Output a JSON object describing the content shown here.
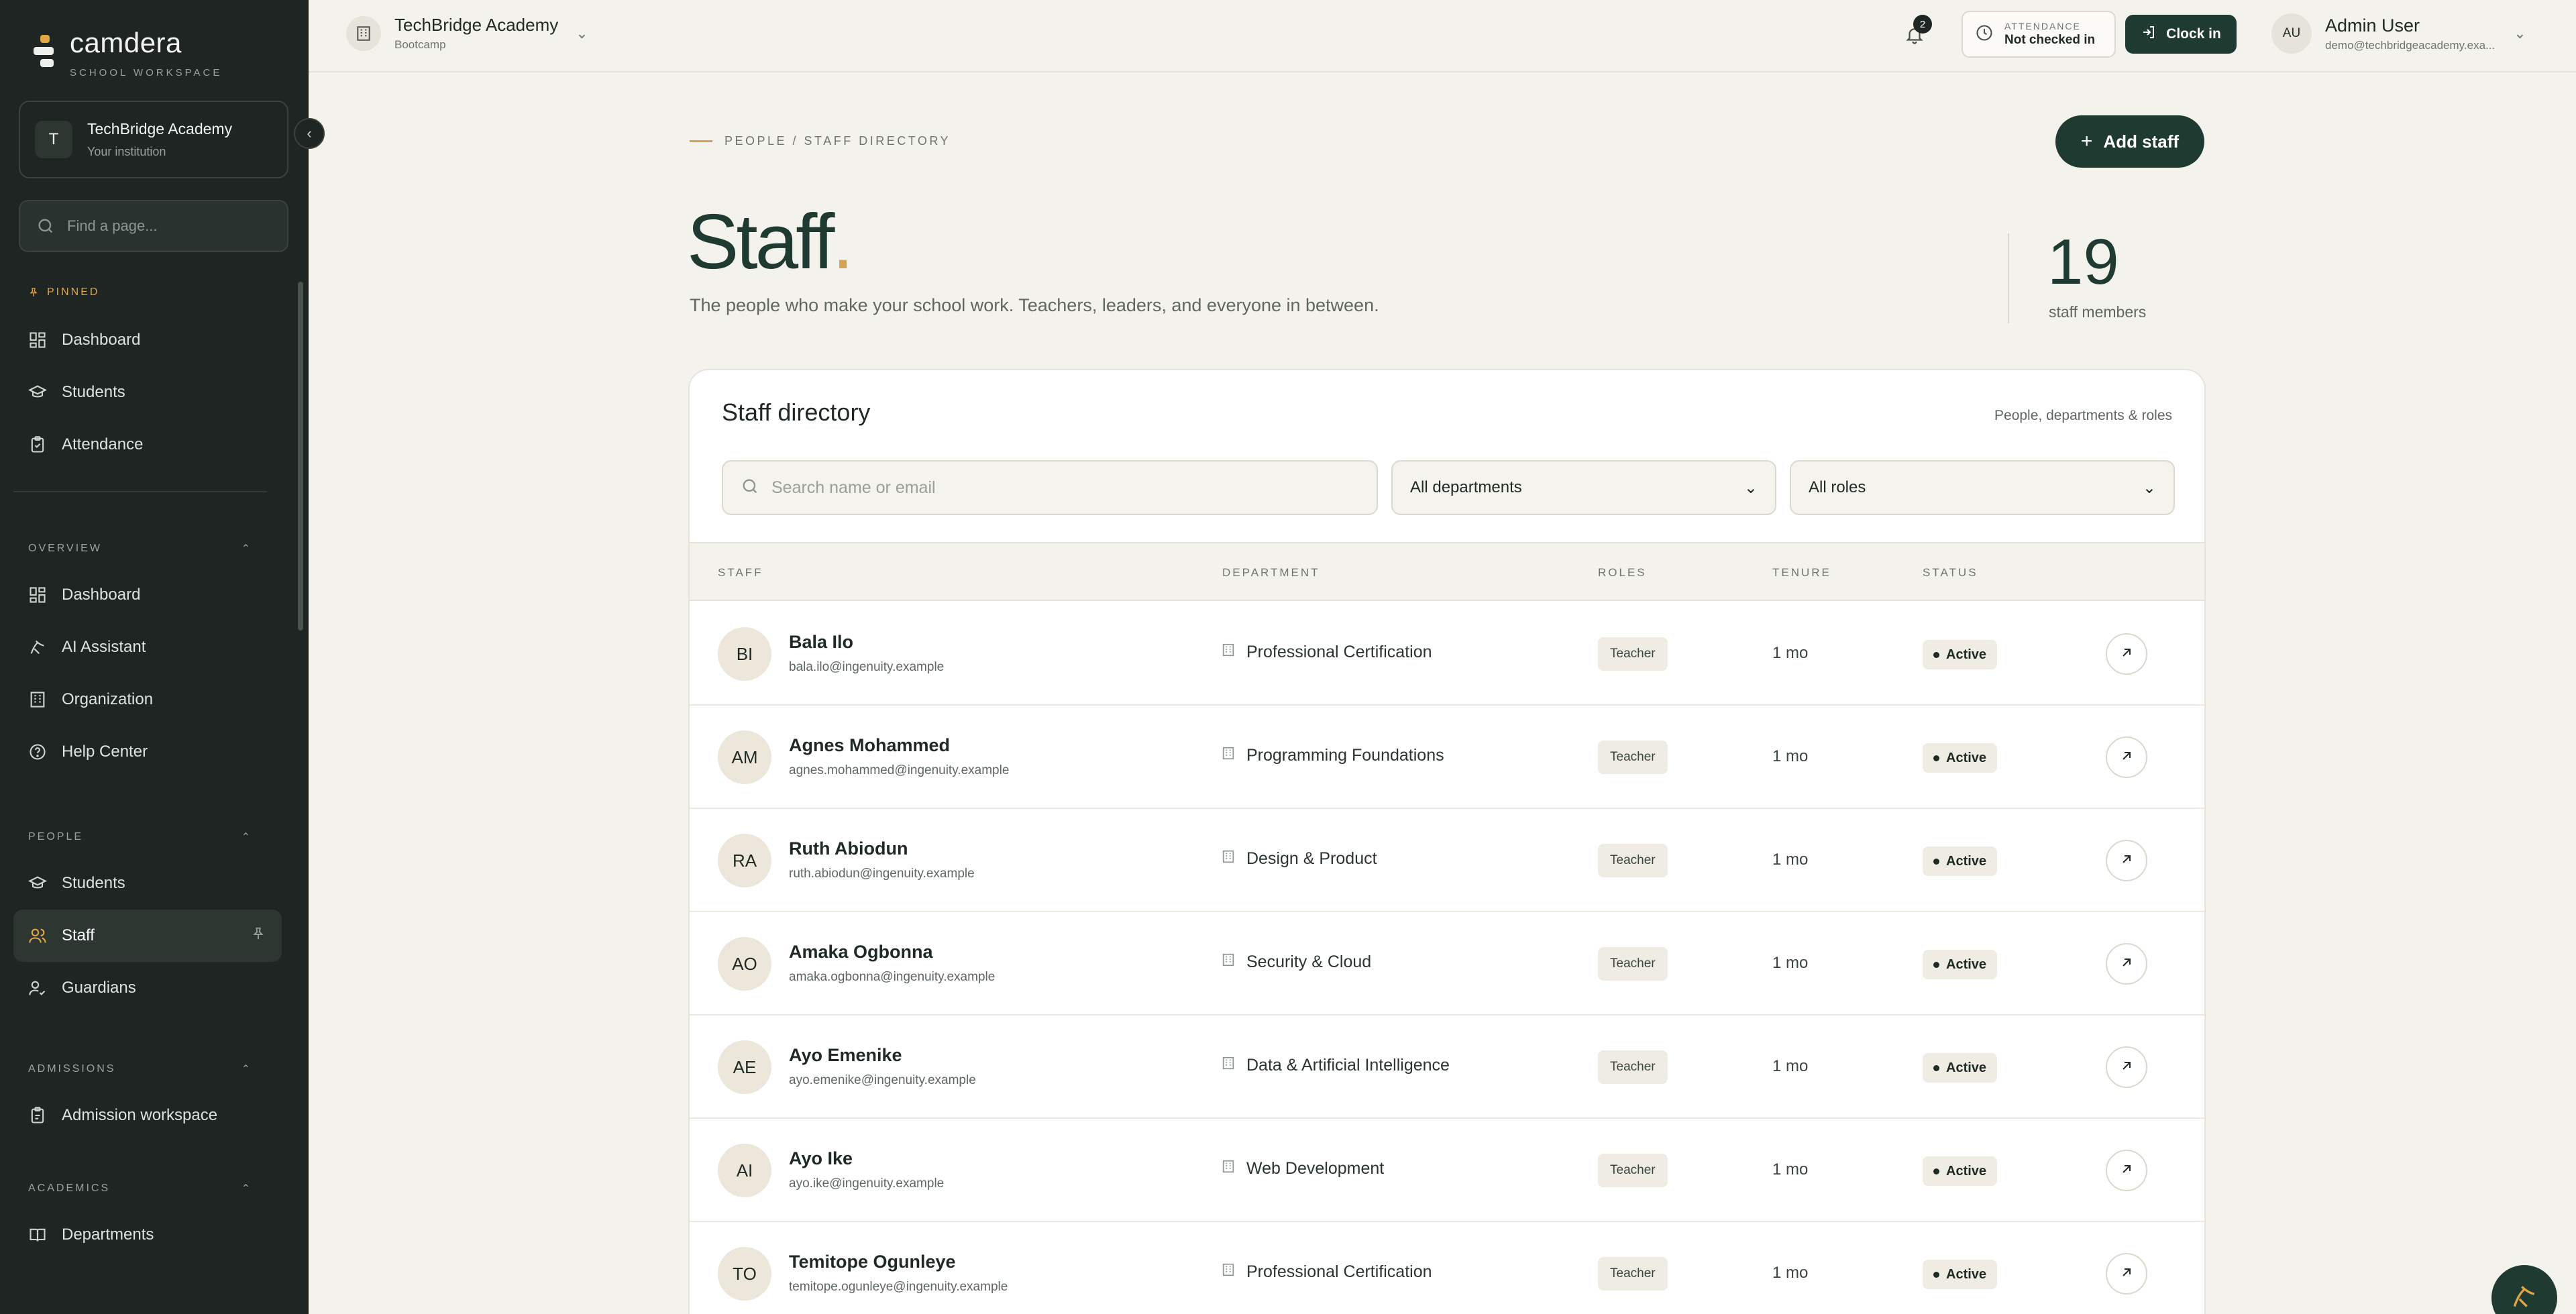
{
  "brand": {
    "name": "camdera",
    "subtitle": "SCHOOL WORKSPACE"
  },
  "institution_card": {
    "initial": "T",
    "name": "TechBridge Academy",
    "subtitle": "Your institution"
  },
  "sidebar_search": {
    "placeholder": "Find a page..."
  },
  "sidebar": {
    "pinned_label": "PINNED",
    "pinned": [
      {
        "label": "Dashboard",
        "icon": "grid-icon"
      },
      {
        "label": "Students",
        "icon": "graduation-cap-icon"
      },
      {
        "label": "Attendance",
        "icon": "clipboard-icon"
      }
    ],
    "sections": [
      {
        "label": "OVERVIEW",
        "items": [
          {
            "label": "Dashboard",
            "icon": "grid-icon"
          },
          {
            "label": "AI Assistant",
            "icon": "sparkle-icon"
          },
          {
            "label": "Organization",
            "icon": "building-icon"
          },
          {
            "label": "Help Center",
            "icon": "help-icon"
          }
        ]
      },
      {
        "label": "PEOPLE",
        "items": [
          {
            "label": "Students",
            "icon": "graduation-cap-icon"
          },
          {
            "label": "Staff",
            "icon": "users-icon",
            "active": true
          },
          {
            "label": "Guardians",
            "icon": "user-check-icon"
          }
        ]
      },
      {
        "label": "ADMISSIONS",
        "items": [
          {
            "label": "Admission workspace",
            "icon": "clipboard-icon"
          }
        ]
      },
      {
        "label": "ACADEMICS",
        "items": [
          {
            "label": "Departments",
            "icon": "book-icon"
          }
        ]
      }
    ]
  },
  "topbar": {
    "institution_name": "TechBridge Academy",
    "institution_type": "Bootcamp",
    "notification_count": "2",
    "attendance_label": "ATTENDANCE",
    "attendance_status": "Not checked in",
    "clock_in_label": "Clock in",
    "user_initials": "AU",
    "user_name": "Admin User",
    "user_email": "demo@techbridgeacademy.exa..."
  },
  "page": {
    "breadcrumb": "PEOPLE / STAFF DIRECTORY",
    "add_button": "Add staff",
    "title": "Staff",
    "title_dot": ".",
    "subtitle": "The people who make your school work. Teachers, leaders, and everyone in between.",
    "count": "19",
    "count_label": "staff members"
  },
  "directory": {
    "title": "Staff directory",
    "note": "People, departments & roles",
    "search_placeholder": "Search name or email",
    "department_filter": "All departments",
    "role_filter": "All roles",
    "columns": [
      "STAFF",
      "DEPARTMENT",
      "ROLES",
      "TENURE",
      "STATUS"
    ],
    "rows": [
      {
        "initials": "BI",
        "name": "Bala Ilo",
        "email": "bala.ilo@ingenuity.example",
        "department": "Professional Certification",
        "role": "Teacher",
        "tenure": "1 mo",
        "status": "Active"
      },
      {
        "initials": "AM",
        "name": "Agnes Mohammed",
        "email": "agnes.mohammed@ingenuity.example",
        "department": "Programming Foundations",
        "role": "Teacher",
        "tenure": "1 mo",
        "status": "Active"
      },
      {
        "initials": "RA",
        "name": "Ruth Abiodun",
        "email": "ruth.abiodun@ingenuity.example",
        "department": "Design & Product",
        "role": "Teacher",
        "tenure": "1 mo",
        "status": "Active"
      },
      {
        "initials": "AO",
        "name": "Amaka Ogbonna",
        "email": "amaka.ogbonna@ingenuity.example",
        "department": "Security & Cloud",
        "role": "Teacher",
        "tenure": "1 mo",
        "status": "Active"
      },
      {
        "initials": "AE",
        "name": "Ayo Emenike",
        "email": "ayo.emenike@ingenuity.example",
        "department": "Data & Artificial Intelligence",
        "role": "Teacher",
        "tenure": "1 mo",
        "status": "Active"
      },
      {
        "initials": "AI",
        "name": "Ayo Ike",
        "email": "ayo.ike@ingenuity.example",
        "department": "Web Development",
        "role": "Teacher",
        "tenure": "1 mo",
        "status": "Active"
      },
      {
        "initials": "TO",
        "name": "Temitope Ogunleye",
        "email": "temitope.ogunleye@ingenuity.example",
        "department": "Professional Certification",
        "role": "Teacher",
        "tenure": "1 mo",
        "status": "Active"
      }
    ]
  },
  "colors": {
    "sidebar_bg": "#1e2522",
    "accent": "#d4a255",
    "primary": "#1f3a30",
    "page_bg": "#f4f2ec"
  }
}
